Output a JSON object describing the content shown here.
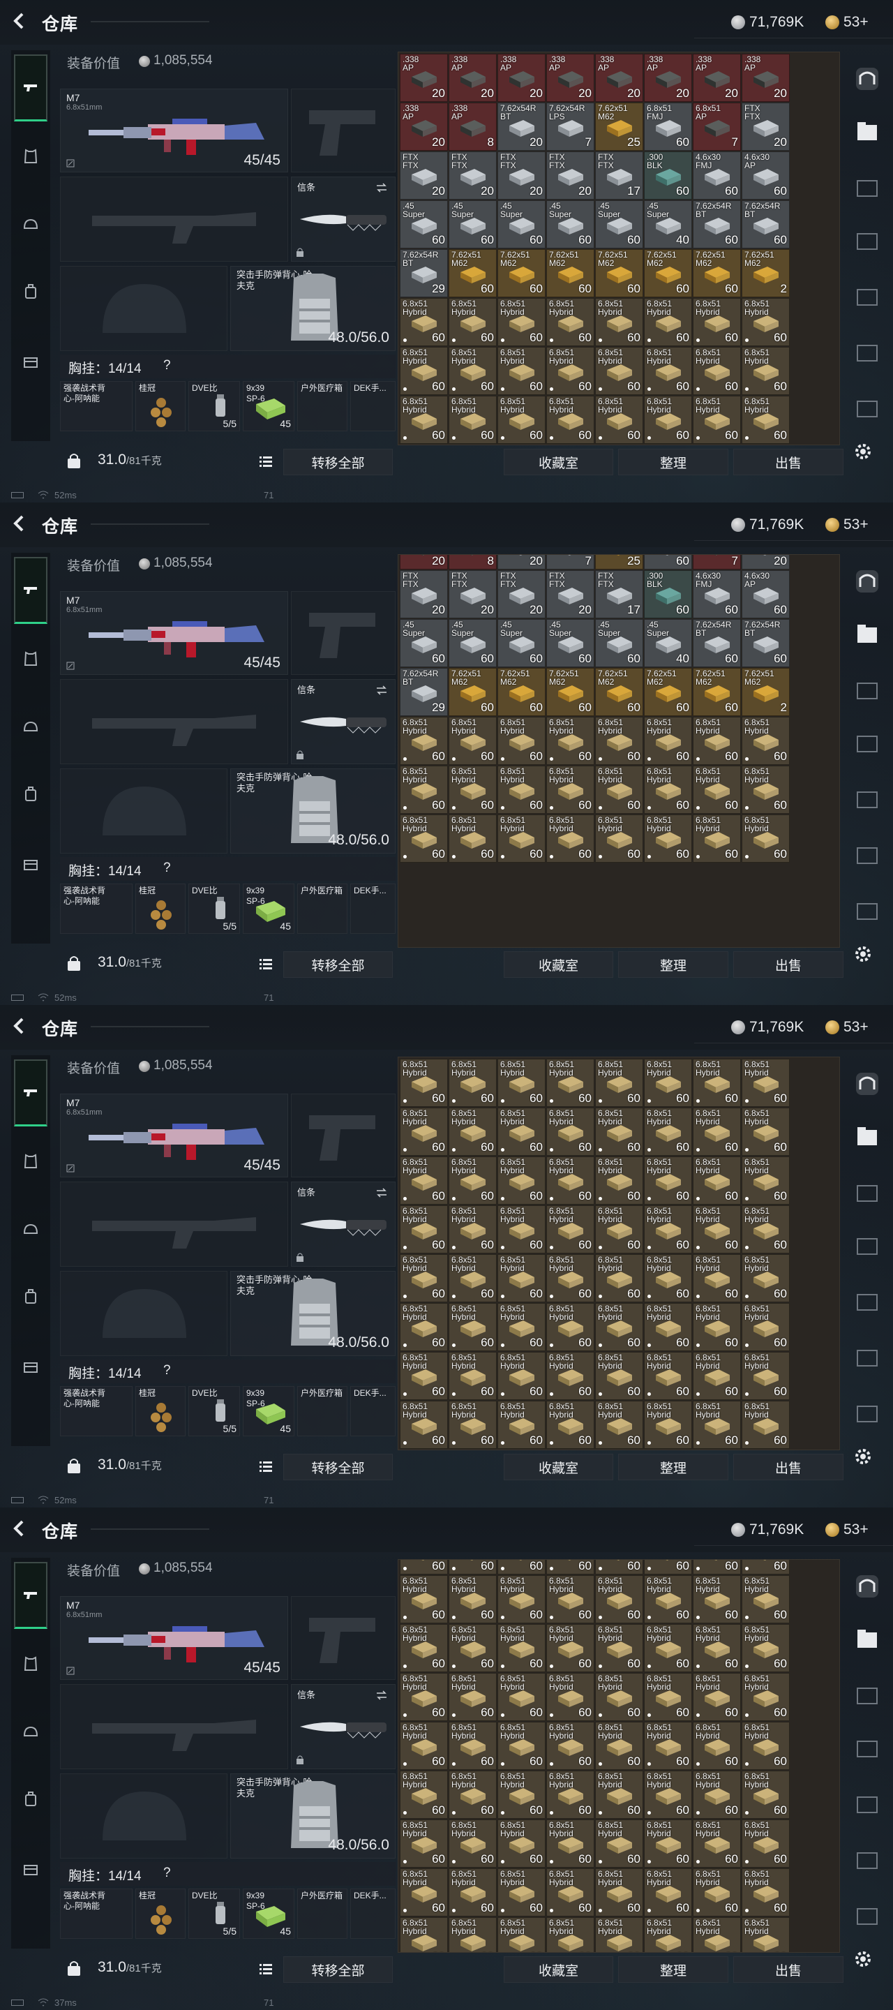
{
  "frames": [
    {
      "status": {
        "ping": "52ms",
        "fps": "71"
      },
      "grid": {
        "preset": "A"
      }
    },
    {
      "status": {
        "ping": "52ms",
        "fps": "71"
      },
      "grid": {
        "preset": "B"
      }
    },
    {
      "status": {
        "ping": "52ms",
        "fps": "71"
      },
      "grid": {
        "preset": "C"
      }
    },
    {
      "status": {
        "ping": "37ms",
        "fps": "71"
      },
      "grid": {
        "preset": "D"
      }
    }
  ],
  "header": {
    "title": "仓库",
    "currency_silver": "71,769K",
    "currency_gold": "53+"
  },
  "equipment": {
    "value_label": "装备价值",
    "value": "1,085,554",
    "primary": {
      "name": "M7",
      "caliber": "6.8x51mm",
      "ammo": "45/45"
    },
    "melee": {
      "name": "信条"
    },
    "armor": {
      "name": "突击手防弹背心-哈夫克",
      "durability": "48.0/56.0"
    },
    "rig": {
      "label": "胸挂：14/14",
      "help": "?"
    },
    "rig_slots": [
      {
        "name": "强袭战术背心-阿呐能",
        "count": ""
      },
      {
        "name": "桂冠",
        "count": ""
      },
      {
        "name": "DVE比",
        "count": "5/5"
      },
      {
        "name": "9x39 SP-6",
        "count": "45"
      },
      {
        "name": "户外医疗箱",
        "count": ""
      },
      {
        "name": "DEK手...",
        "count": ""
      }
    ]
  },
  "bottom": {
    "weight_value": "31.0",
    "weight_max": "/81千克",
    "transfer_all": "转移全部",
    "vault": "收藏室",
    "sort": "整理",
    "sell": "出售"
  },
  "grid_presets": {
    "A": [
      [
        {
          "l": ".338\nAP",
          "c": "20",
          "k": "red"
        },
        {
          "l": ".338\nAP",
          "c": "20",
          "k": "red"
        },
        {
          "l": ".338\nAP",
          "c": "20",
          "k": "red"
        },
        {
          "l": ".338\nAP",
          "c": "20",
          "k": "red"
        },
        {
          "l": ".338\nAP",
          "c": "20",
          "k": "red"
        },
        {
          "l": ".338\nAP",
          "c": "20",
          "k": "red"
        },
        {
          "l": ".338\nAP",
          "c": "20",
          "k": "red"
        },
        {
          "l": ".338\nAP",
          "c": "20",
          "k": "red"
        }
      ],
      [
        {
          "l": ".338\nAP",
          "c": "20",
          "k": "red"
        },
        {
          "l": ".338\nAP",
          "c": "8",
          "k": "red"
        },
        {
          "l": "7.62x54R\nBT",
          "c": "20",
          "k": "gray"
        },
        {
          "l": "7.62x54R\nLPS",
          "c": "7",
          "k": "gray"
        },
        {
          "l": "7.62x51\nM62",
          "c": "25",
          "k": "gold"
        },
        {
          "l": "6.8x51\nFMJ",
          "c": "60",
          "k": "gray"
        },
        {
          "l": "6.8x51\nAP",
          "c": "7",
          "k": "red"
        },
        {
          "l": "FTX\nFTX",
          "c": "20",
          "k": "gray"
        }
      ],
      [
        {
          "l": "FTX\nFTX",
          "c": "20",
          "k": "gray"
        },
        {
          "l": "FTX\nFTX",
          "c": "20",
          "k": "gray"
        },
        {
          "l": "FTX\nFTX",
          "c": "20",
          "k": "gray"
        },
        {
          "l": "FTX\nFTX",
          "c": "20",
          "k": "gray"
        },
        {
          "l": "FTX\nFTX",
          "c": "17",
          "k": "gray"
        },
        {
          "l": ".300\nBLK",
          "c": "60",
          "k": "teal"
        },
        {
          "l": "4.6x30\nFMJ",
          "c": "60",
          "k": "gray"
        },
        {
          "l": "4.6x30\nAP",
          "c": "60",
          "k": "gray"
        }
      ],
      [
        {
          "l": ".45\nSuper",
          "c": "60",
          "k": "gray"
        },
        {
          "l": ".45\nSuper",
          "c": "60",
          "k": "gray"
        },
        {
          "l": ".45\nSuper",
          "c": "60",
          "k": "gray"
        },
        {
          "l": ".45\nSuper",
          "c": "60",
          "k": "gray"
        },
        {
          "l": ".45\nSuper",
          "c": "60",
          "k": "gray"
        },
        {
          "l": ".45\nSuper",
          "c": "40",
          "k": "gray"
        },
        {
          "l": "7.62x54R\nBT",
          "c": "60",
          "k": "gray"
        },
        {
          "l": "7.62x54R\nBT",
          "c": "60",
          "k": "gray"
        }
      ],
      [
        {
          "l": "7.62x54R\nBT",
          "c": "29",
          "k": "gray"
        },
        {
          "l": "7.62x51\nM62",
          "c": "60",
          "k": "gold"
        },
        {
          "l": "7.62x51\nM62",
          "c": "60",
          "k": "gold"
        },
        {
          "l": "7.62x51\nM62",
          "c": "60",
          "k": "gold"
        },
        {
          "l": "7.62x51\nM62",
          "c": "60",
          "k": "gold"
        },
        {
          "l": "7.62x51\nM62",
          "c": "60",
          "k": "gold"
        },
        {
          "l": "7.62x51\nM62",
          "c": "60",
          "k": "gold"
        },
        {
          "l": "7.62x51\nM62",
          "c": "2",
          "k": "gold"
        }
      ],
      [
        {
          "l": "6.8x51\nHybrid",
          "c": "60",
          "k": "brass"
        },
        {
          "l": "6.8x51\nHybrid",
          "c": "60",
          "k": "brass"
        },
        {
          "l": "6.8x51\nHybrid",
          "c": "60",
          "k": "brass"
        },
        {
          "l": "6.8x51\nHybrid",
          "c": "60",
          "k": "brass"
        },
        {
          "l": "6.8x51\nHybrid",
          "c": "60",
          "k": "brass"
        },
        {
          "l": "6.8x51\nHybrid",
          "c": "60",
          "k": "brass"
        },
        {
          "l": "6.8x51\nHybrid",
          "c": "60",
          "k": "brass"
        },
        {
          "l": "6.8x51\nHybrid",
          "c": "60",
          "k": "brass"
        }
      ],
      [
        {
          "l": "6.8x51\nHybrid",
          "c": "60",
          "k": "brass"
        },
        {
          "l": "6.8x51\nHybrid",
          "c": "60",
          "k": "brass"
        },
        {
          "l": "6.8x51\nHybrid",
          "c": "60",
          "k": "brass"
        },
        {
          "l": "6.8x51\nHybrid",
          "c": "60",
          "k": "brass"
        },
        {
          "l": "6.8x51\nHybrid",
          "c": "60",
          "k": "brass"
        },
        {
          "l": "6.8x51\nHybrid",
          "c": "60",
          "k": "brass"
        },
        {
          "l": "6.8x51\nHybrid",
          "c": "60",
          "k": "brass"
        },
        {
          "l": "6.8x51\nHybrid",
          "c": "60",
          "k": "brass"
        }
      ],
      [
        {
          "l": "6.8x51\nHybrid",
          "c": "60",
          "k": "brass"
        },
        {
          "l": "6.8x51\nHybrid",
          "c": "60",
          "k": "brass"
        },
        {
          "l": "6.8x51\nHybrid",
          "c": "60",
          "k": "brass"
        },
        {
          "l": "6.8x51\nHybrid",
          "c": "60",
          "k": "brass"
        },
        {
          "l": "6.8x51\nHybrid",
          "c": "60",
          "k": "brass"
        },
        {
          "l": "6.8x51\nHybrid",
          "c": "60",
          "k": "brass"
        },
        {
          "l": "6.8x51\nHybrid",
          "c": "60",
          "k": "brass"
        },
        {
          "l": "6.8x51\nHybrid",
          "c": "60",
          "k": "brass"
        }
      ]
    ]
  },
  "colors": {
    "accent_green": "#2fd089",
    "cell_red": "#5a2a2c",
    "cell_gray": "#474b4f",
    "cell_gold": "#5b4a2a",
    "cell_brass": "#4a4234",
    "cell_teal": "#3b4a48"
  },
  "icons": {
    "back": "back-arrow-icon",
    "silver": "silver-coin-icon",
    "gold": "gold-coin-icon",
    "settings": "gear-icon",
    "lock": "lock-icon",
    "list": "list-icon"
  }
}
